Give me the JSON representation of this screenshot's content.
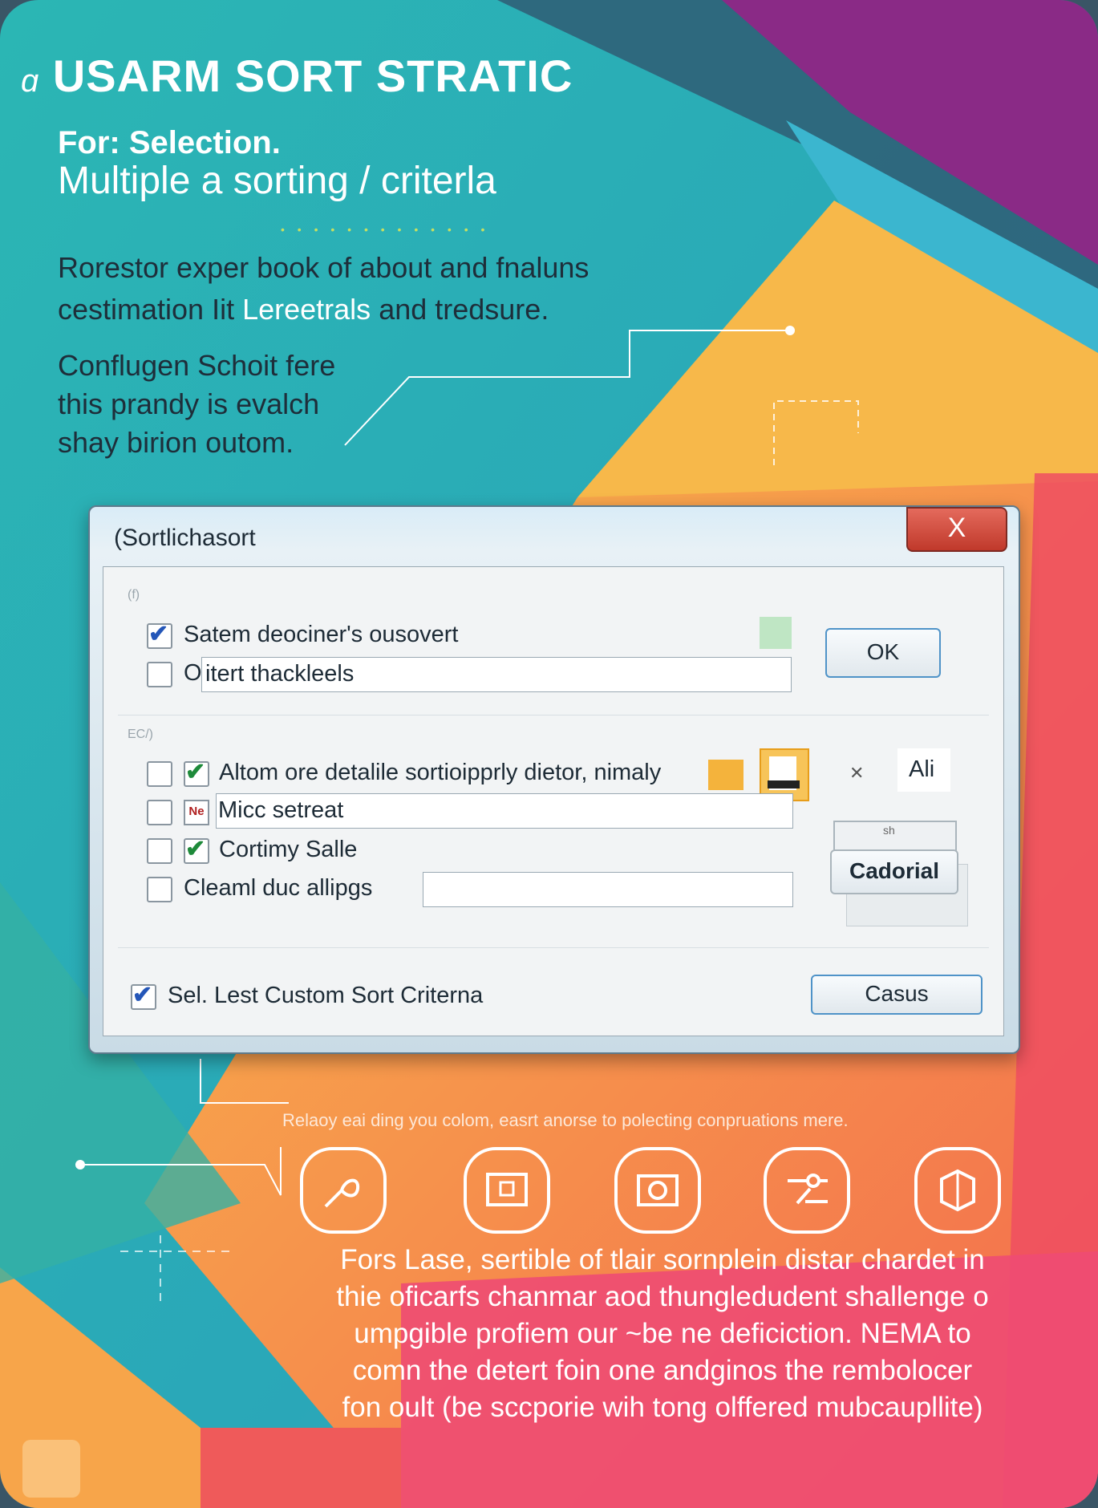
{
  "poster": {
    "title": "USARM SORT STRATIC",
    "subtitle_line1": "For: Selection.",
    "subtitle_line2": "Multiple a sorting / criterla",
    "paragraph1_line1": "Rorestor exper book of about and fnaluns",
    "paragraph1_line2_a": "cestimation Iit ",
    "paragraph1_line2_hl": "Lereetrals",
    "paragraph1_line2_b": " and tredsure.",
    "paragraph2_line1": "Conflugen Schoit fere",
    "paragraph2_line2": "this prandy is evalch",
    "paragraph2_line3": "shay birion outom.",
    "caption": "Relaoy eai ding you colom, easrt anorse to polecting conpruations mere.",
    "paragraph3": [
      "Fors Lase, sertible of tlair sornplein distar chardet in",
      "thie oficarfs chanmar aod thungledudent shallenge o",
      "umpgible profiem our ~be ne deficiction. NEMA to",
      "comn the detert foin one andginos the rembolocer",
      "fon oult (be sccporie wih tong olffered mubcaupllite)"
    ],
    "feature_icons": [
      "hand-pointer-icon",
      "book-icon",
      "gear-film-icon",
      "network-icon",
      "package-icon"
    ]
  },
  "dialog": {
    "title": "(Sortlichasort",
    "close_label": "X",
    "group1_label": "(f)",
    "group2_label": "EC/)",
    "row1_label": "Satem deociner's ousovert",
    "row2_prefix": "O",
    "row2_value": "itert thackleels",
    "ok_label": "OK",
    "row3_label": "Altom ore detalile sortioipprly dietor, nimaly",
    "row4_value": "Micc setreat",
    "row5_label": "Cortimy Salle",
    "row6_label": "Cleaml duc allipgs",
    "ali_label": "Ali",
    "stack_small_label": "sh",
    "cadorial_label": "Cadorial",
    "bottom_checkbox_label": "Sel. Lest Custom Sort Criterna",
    "casus_label": "Casus",
    "row4_icon_text": "Ne"
  },
  "colors": {
    "teal": "#2bb0b3",
    "purple": "#8a2a86",
    "yellow": "#f7b84a",
    "orange": "#f48a4c",
    "pink": "#ee4b73",
    "accent_blue": "#4f93c8"
  }
}
